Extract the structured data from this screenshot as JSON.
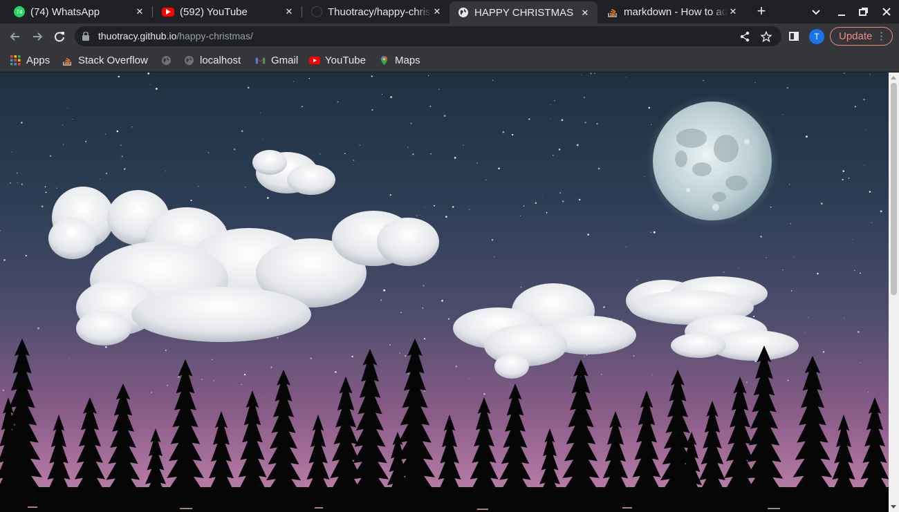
{
  "browser": {
    "tabs": [
      {
        "title": "(74) WhatsApp",
        "favicon": "whatsapp-icon",
        "favicon_color": "#25d366",
        "favicon_text": "74"
      },
      {
        "title": "(592) YouTube",
        "favicon": "youtube-icon",
        "favicon_color": "#ff0000"
      },
      {
        "title": "Thuotracy/happy-christmas",
        "favicon": "github-icon",
        "favicon_color": "#3c3c3c"
      },
      {
        "title": "HAPPY CHRISTMAS",
        "favicon": "globe-icon",
        "favicon_color": "#e8eaed"
      },
      {
        "title": "markdown - How to add",
        "favicon": "stackoverflow-icon",
        "favicon_color": "#f48024"
      }
    ],
    "active_tab": 3,
    "url_host": "thuotracy.github.io",
    "url_path": "/happy-christmas/",
    "avatar_letter": "T",
    "update_label": "Update",
    "accent_color": "#f28b82"
  },
  "bookmarks": [
    {
      "label": "Apps",
      "icon": "apps-grid-icon"
    },
    {
      "label": "Stack Overflow",
      "icon": "stackoverflow-icon"
    },
    {
      "label": "",
      "icon": "globe-icon"
    },
    {
      "label": "localhost",
      "icon": "globe-icon"
    },
    {
      "label": "Gmail",
      "icon": "gmail-icon"
    },
    {
      "label": "YouTube",
      "icon": "youtube-icon"
    },
    {
      "label": "Maps",
      "icon": "maps-pin-icon"
    }
  ],
  "page": {
    "scene": "night-sky-moon-clouds-pine-forest",
    "sky_colors": [
      "#1e3040",
      "#4d4c6c",
      "#c586b0"
    ]
  }
}
